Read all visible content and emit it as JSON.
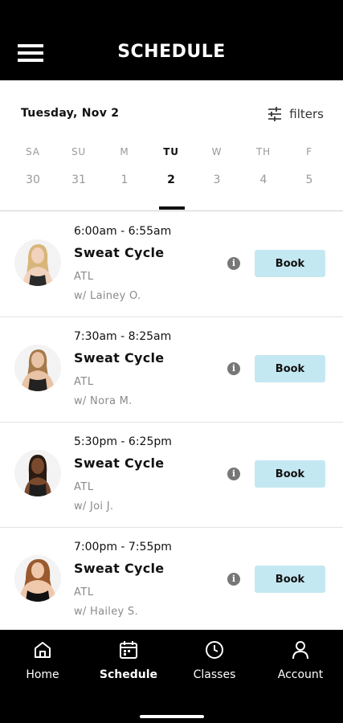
{
  "header": {
    "title": "SCHEDULE",
    "menu_icon": "hamburger-menu-icon"
  },
  "date_bar": {
    "selected_date": "Tuesday, Nov 2",
    "filters_label": "filters",
    "filters_icon": "sliders-icon"
  },
  "week": [
    {
      "name": "SA",
      "num": "30",
      "active": false
    },
    {
      "name": "SU",
      "num": "31",
      "active": false
    },
    {
      "name": "M",
      "num": "1",
      "active": false
    },
    {
      "name": "TU",
      "num": "2",
      "active": true
    },
    {
      "name": "W",
      "num": "3",
      "active": false
    },
    {
      "name": "TH",
      "num": "4",
      "active": false
    },
    {
      "name": "F",
      "num": "5",
      "active": false
    }
  ],
  "classes": [
    {
      "time": "6:00am - 6:55am",
      "name": "Sweat Cycle",
      "location": "ATL",
      "instructor": "w/ Lainey O.",
      "book_label": "Book",
      "skin": "#f0d2bd",
      "hair": "#d8b57a",
      "top": "#2a2a2a"
    },
    {
      "time": "7:30am - 8:25am",
      "name": "Sweat Cycle",
      "location": "ATL",
      "instructor": "w/ Nora M.",
      "book_label": "Book",
      "skin": "#e9c3a5",
      "hair": "#a5794a",
      "top": "#222222"
    },
    {
      "time": "5:30pm - 6:25pm",
      "name": "Sweat Cycle",
      "location": "ATL",
      "instructor": "w/ Joi J.",
      "book_label": "Book",
      "skin": "#7a4a2e",
      "hair": "#2a1a10",
      "top": "#1e1e1e"
    },
    {
      "time": "7:00pm - 7:55pm",
      "name": "Sweat Cycle",
      "location": "ATL",
      "instructor": "w/ Hailey S.",
      "book_label": "Book",
      "skin": "#efc7aa",
      "hair": "#9a5a2e",
      "top": "#111111"
    }
  ],
  "tabs": [
    {
      "label": "Home",
      "icon": "home-icon",
      "active": false
    },
    {
      "label": "Schedule",
      "icon": "calendar-icon",
      "active": true
    },
    {
      "label": "Classes",
      "icon": "clock-icon",
      "active": false
    },
    {
      "label": "Account",
      "icon": "user-icon",
      "active": false
    }
  ],
  "colors": {
    "book_button": "#c4e8f1",
    "bar_background": "#000000",
    "text_primary": "#111111",
    "text_muted": "#8a8a8a"
  }
}
